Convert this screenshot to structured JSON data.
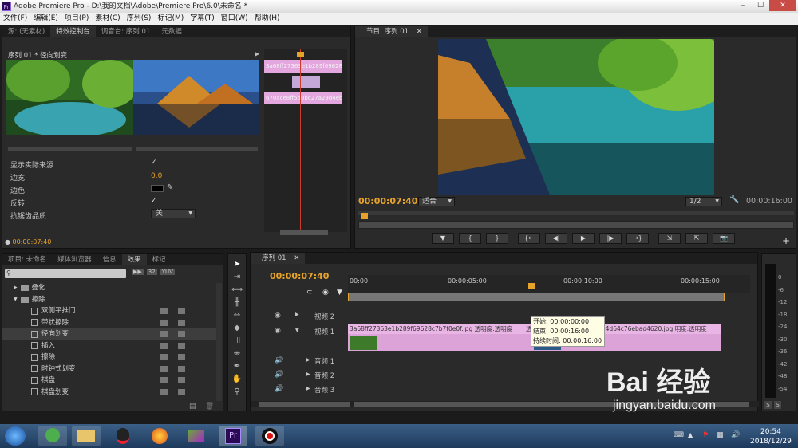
{
  "titlebar": {
    "title": "Adobe Premiere Pro - D:\\我的文档\\Adobe\\Premiere Pro\\6.0\\未命名 *",
    "min": "–",
    "max": "☐",
    "close": "✕"
  },
  "menu": [
    "文件(F)",
    "编辑(E)",
    "项目(P)",
    "素材(C)",
    "序列(S)",
    "标记(M)",
    "字幕(T)",
    "窗口(W)",
    "帮助(H)"
  ],
  "source_panel": {
    "tabs": [
      "源: (无素材)",
      "特效控制台",
      "调音台: 序列 01",
      "元数据"
    ],
    "title": "序列 01 * 径向划变",
    "mini_timeline_labels": [
      "3a68ff27363e1b289f69628",
      "670ace8ff5d0bc27a29d4eb"
    ],
    "props": [
      {
        "label": "显示实际来源",
        "value": "✓"
      },
      {
        "label": "边宽",
        "value": "0.0"
      },
      {
        "label": "边色",
        "value": ""
      },
      {
        "label": "反转",
        "value": "✓"
      },
      {
        "label": "抗锯齿品质",
        "value": "关"
      }
    ],
    "timecode": "00:00:07:40"
  },
  "program_panel": {
    "tab": "节目: 序列 01",
    "timecode": "00:00:07:40",
    "fit": "适合",
    "quality": "1/2",
    "duration": "00:00:16:00",
    "transport": [
      "▼",
      "{",
      "}",
      "{←",
      "◀|",
      "▶",
      "|▶",
      "→}",
      "⇲",
      "⇱",
      "📷"
    ]
  },
  "project_panel": {
    "tabs": [
      "项目: 未命名",
      "媒体浏览器",
      "信息",
      "效果",
      "标记"
    ],
    "badges": [
      "▶▶",
      "32",
      "YUV"
    ],
    "effects": [
      {
        "label": "叠化",
        "level": 1,
        "folder": true
      },
      {
        "label": "擦除",
        "level": 1,
        "folder": true,
        "open": true
      },
      {
        "label": "双侧平推门",
        "level": 2
      },
      {
        "label": "带状擦除",
        "level": 2
      },
      {
        "label": "径向划变",
        "level": 2,
        "selected": true
      },
      {
        "label": "插入",
        "level": 2
      },
      {
        "label": "擦除",
        "level": 2
      },
      {
        "label": "时钟式划变",
        "level": 2
      },
      {
        "label": "棋盘",
        "level": 2
      },
      {
        "label": "棋盘划变",
        "level": 2
      }
    ]
  },
  "timeline": {
    "tab": "序列 01",
    "timecode": "00:00:07:40",
    "ruler": [
      "00:00",
      "00:00:05:00",
      "00:00:10:00",
      "00:00:15:00"
    ],
    "tracks": [
      {
        "name": "视频 2",
        "type": "video"
      },
      {
        "name": "视频 1",
        "type": "video"
      },
      {
        "name": "音频 1",
        "type": "audio"
      },
      {
        "name": "音频 2",
        "type": "audio"
      },
      {
        "name": "音频 3",
        "type": "audio"
      }
    ],
    "clip1": "3a68ff27363e1b289f69628c7b7f0e0f.jpg",
    "clip1_fx": "透明度:透明度",
    "clip2": "04d64c76ebad4620.jpg",
    "clip2_fx": "明度:透明度",
    "clip_mid": "透明度",
    "tooltip": {
      "start": "开始: 00:00:00:00",
      "end": "结束: 00:00:16:00",
      "duration": "持续时间: 00:00:16:00"
    }
  },
  "audio_meter": {
    "ticks": [
      "0",
      "-6",
      "-12",
      "-18",
      "-24",
      "-30",
      "-36",
      "-42",
      "-48",
      "-54"
    ],
    "solo": [
      "S",
      "S"
    ]
  },
  "taskbar": {
    "time": "20:54",
    "date": "2018/12/29"
  },
  "watermark": {
    "text": "Bai 经验",
    "url": "jingyan.baidu.com"
  }
}
